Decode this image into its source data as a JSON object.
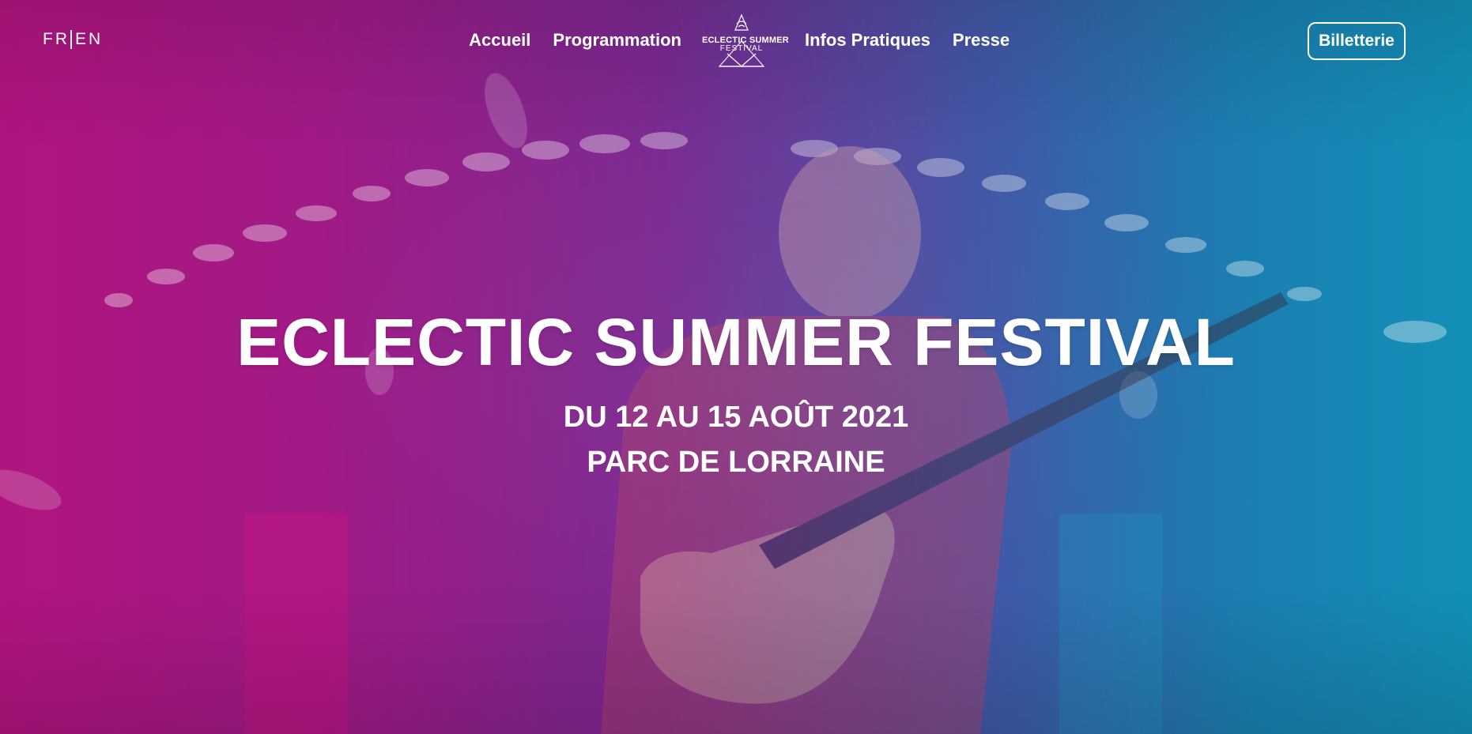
{
  "header": {
    "lang": {
      "fr": "FR",
      "en": "EN"
    },
    "nav_left": [
      "Accueil",
      "Programmation"
    ],
    "nav_right": [
      "Infos Pratiques",
      "Presse"
    ],
    "logo": {
      "line1": "ECLECTIC SUMMER",
      "line2": "FESTIVAL"
    },
    "ticket_label": "Billetterie"
  },
  "hero": {
    "title": "ECLECTIC SUMMER FESTIVAL",
    "dates": "DU 12 AU 15 AOÛT 2021",
    "place": "PARC DE LORRAINE",
    "background_image": "guitarist-performing-on-stage-photo"
  },
  "colors": {
    "gradient_left": "#b0157f",
    "gradient_mid": "#7a2a92",
    "gradient_right": "#1390b8",
    "text": "#ffffff"
  }
}
